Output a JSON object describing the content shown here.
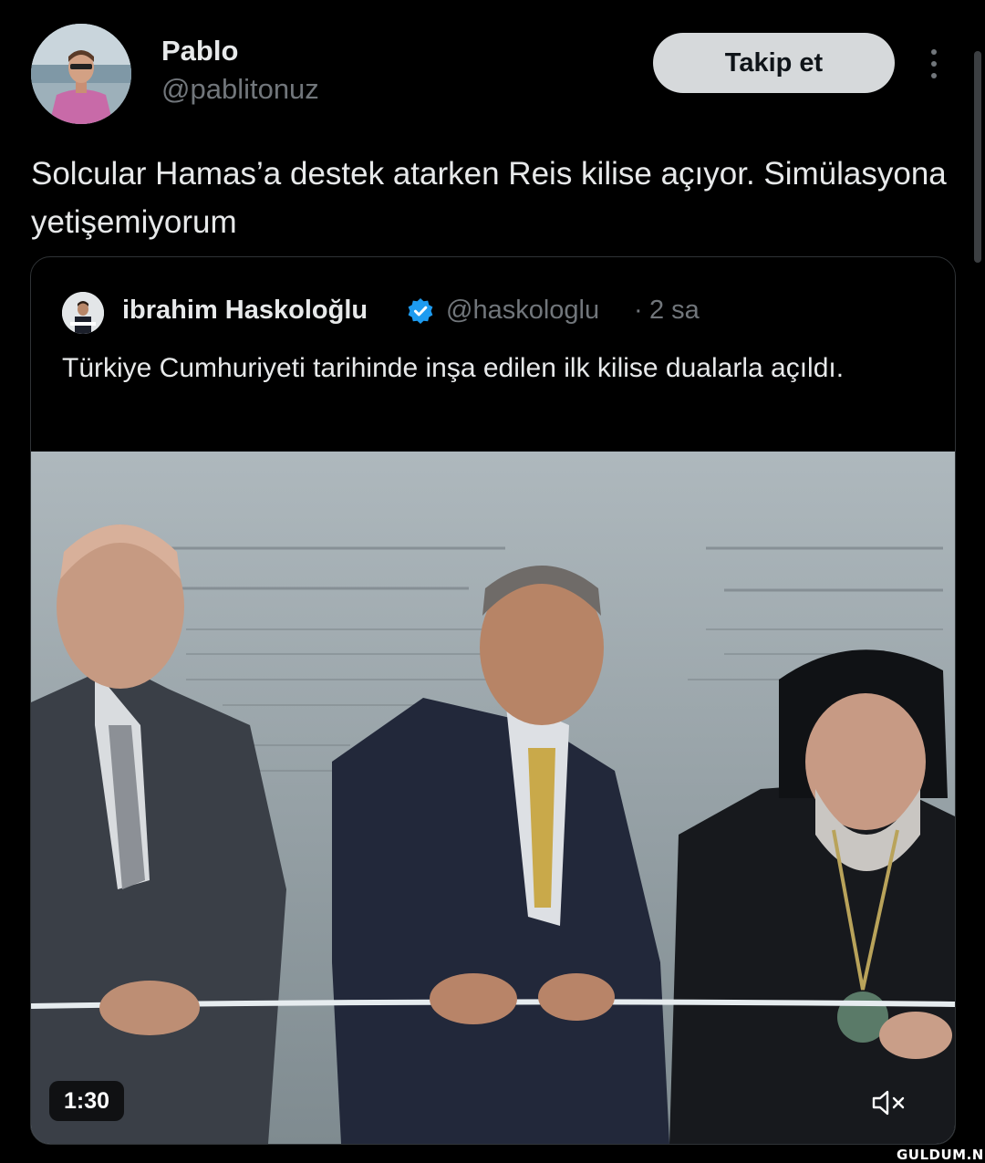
{
  "author": {
    "display_name": "Pablo",
    "handle": "@pablitonuz",
    "avatar_icon": "profile-photo-avatar"
  },
  "actions": {
    "follow_label": "Takip et",
    "more_icon": "more-vertical-icon"
  },
  "tweet": {
    "text": "Solcular Hamas’a destek atarken Reis kilise açıyor. Simülasyona yetişemiyorum"
  },
  "quoted_tweet": {
    "display_name": "ibrahim Haskoloğlu",
    "verified_icon": "verified-badge-icon",
    "handle": "@haskologlu",
    "separator": "·",
    "time": "2 sa",
    "text": "Türkiye Cumhuriyeti tarihinde inşa edilen ilk kilise dualarla açıldı.",
    "video": {
      "duration": "1:30",
      "mute_icon": "speaker-muted-icon"
    }
  },
  "watermark": "GULDUM.NET",
  "colors": {
    "background": "#000000",
    "primary_text": "#e7e9ea",
    "secondary_text": "#71767b",
    "follow_button_bg": "#d6d9db",
    "verified_blue": "#1d9bf0",
    "border": "#2f3336"
  }
}
